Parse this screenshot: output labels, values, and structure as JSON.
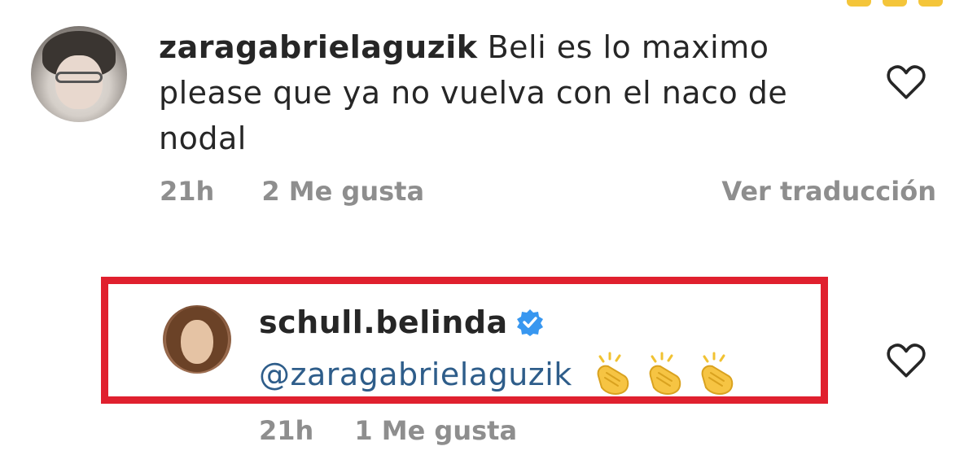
{
  "comment": {
    "username": "zaragabrielaguzik",
    "text": "Beli es lo maximo please que ya no vuelva con el naco de nodal",
    "time": "21h",
    "likes": "2 Me gusta",
    "translate_label": "Ver traducción",
    "avatar_icon": "user-avatar-icon",
    "like_icon": "heart-outline-icon"
  },
  "reply": {
    "username": "schull.belinda",
    "verified_icon": "verified-badge-icon",
    "mention": "@zaragabrielaguzik",
    "emoji": [
      "clapping-hands-icon",
      "clapping-hands-icon",
      "clapping-hands-icon"
    ],
    "time": "21h",
    "likes": "1 Me gusta",
    "avatar_icon": "user-avatar-icon",
    "like_icon": "heart-outline-icon"
  },
  "colors": {
    "highlight_border": "#e0202e",
    "text": "#262626",
    "secondary_text": "#8e8e8e",
    "mention": "#2e5d8a",
    "verified": "#3897f0"
  }
}
